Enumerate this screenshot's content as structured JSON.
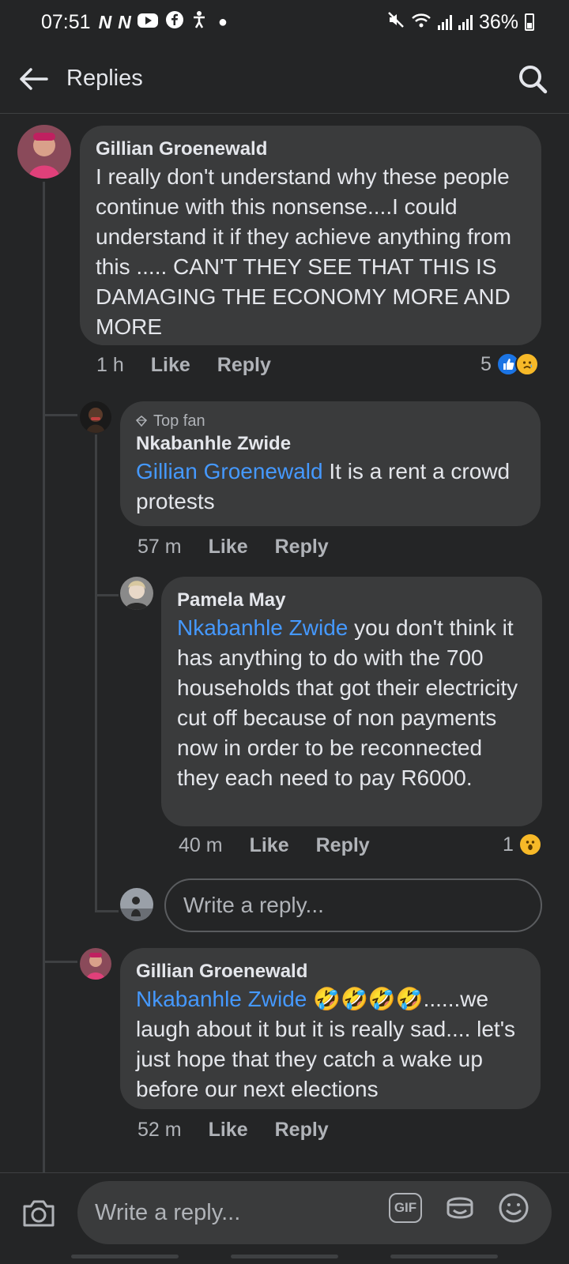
{
  "status_bar": {
    "time": "07:51",
    "battery": "36%"
  },
  "header": {
    "title": "Replies"
  },
  "comments": [
    {
      "author": "Gillian Groenewald",
      "text": "I really don't understand why these people continue with this nonsense....I could understand it if they achieve anything from this ..... CAN'T THEY SEE THAT THIS IS DAMAGING THE ECONOMY MORE AND MORE",
      "time": "1 h",
      "like_label": "Like",
      "reply_label": "Reply",
      "reaction_count": "5",
      "reactions": [
        "like-icon",
        "sad-icon"
      ]
    },
    {
      "badge": "Top fan",
      "author": "Nkabanhle Zwide",
      "mention": "Gillian Groenewald",
      "text": " It is a rent a crowd protests",
      "time": "57 m",
      "like_label": "Like",
      "reply_label": "Reply"
    },
    {
      "author": "Pamela May",
      "mention": "Nkabanhle Zwide",
      "text": " you don't think it has anything to do with the 700 households that got their electricity cut off because of non payments now in order to be reconnected they each need to pay R6000.",
      "time": "40 m",
      "like_label": "Like",
      "reply_label": "Reply",
      "reaction_count": "1",
      "reactions": [
        "wow-icon"
      ]
    },
    {
      "author": "Gillian Groenewald",
      "mention": "Nkabanhle Zwide",
      "emoji": "🤣🤣🤣🤣",
      "text": "......we laugh about it but it is really sad.... let's just hope that they catch a wake up before our next elections",
      "time": "52 m",
      "like_label": "Like",
      "reply_label": "Reply"
    }
  ],
  "inline_reply": {
    "placeholder": "Write a reply..."
  },
  "composer": {
    "placeholder": "Write a reply...",
    "gif_label": "GIF"
  },
  "colors": {
    "background": "#242526",
    "bubble": "#3a3b3c",
    "mention": "#4599ff",
    "like": "#1b74e4"
  }
}
